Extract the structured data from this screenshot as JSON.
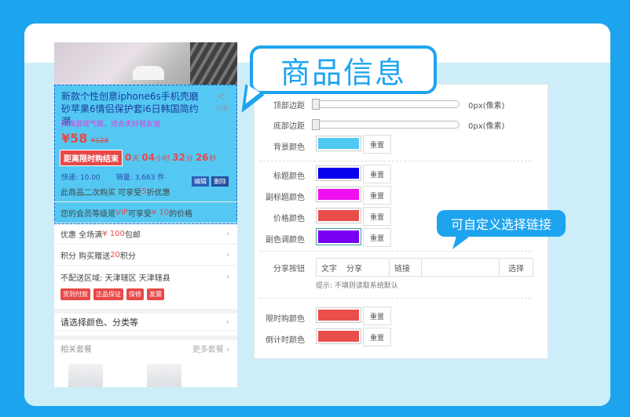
{
  "product": {
    "title": "新款个性创意iphone6s手机壳磨砂苹果6情侣保护套i6日韩国简约潮",
    "share_label": "分享",
    "subtitle": "四海游戏气歌，适合夫好朋友谊",
    "price": "¥58",
    "old_price": "¥128",
    "countdown_label": "距离限时购结束",
    "countdown": {
      "days": "0",
      "day_unit": "天",
      "hours": "04",
      "hour_unit": "小时",
      "minutes": "32",
      "min_unit": "分",
      "seconds": "26",
      "sec_unit": "秒"
    },
    "shipping": "快递: 10.00",
    "sales": "销量: 3,663 件",
    "edit_label": "编辑",
    "delete_label": "删除"
  },
  "rows": {
    "repurchase": {
      "pre": "此商品二次购买 可享受 ",
      "num": "5",
      "post": " 折优惠"
    },
    "vip": {
      "pre": "您的会员等级是 ",
      "level": "VIP",
      "mid": " 可享受 ",
      "amount": "¥ 10",
      "post": " 的价格"
    },
    "discount": {
      "pre": "优惠 全场满 ",
      "amount": "¥ 100",
      "post": " 包邮"
    },
    "points": {
      "pre": "积分 购买赠送 ",
      "num": "20",
      "post": " 积分"
    },
    "no_ship": "不配送区域: 天津辖区 天津辖县",
    "badges": [
      "货到付款",
      "正品保证",
      "保修",
      "发票"
    ],
    "select_spec": "请选择颜色、分类等",
    "related": "相关套餐",
    "more": "更多套餐"
  },
  "settings": {
    "top_margin": {
      "label": "顶部边距",
      "value": "0px(像素)"
    },
    "bottom_margin": {
      "label": "底部边距",
      "value": "0px(像素)"
    },
    "bg_color": {
      "label": "背景颜色",
      "color": "#4fc9f2"
    },
    "title_color": {
      "label": "标题颜色",
      "color": "#0a00ee"
    },
    "subtitle_color": {
      "label": "副标题颜色",
      "color": "#f00ff0"
    },
    "price_color": {
      "label": "价格颜色",
      "color": "#ea4e4b"
    },
    "accent_color": {
      "label": "副色调颜色",
      "color": "#7a00f5"
    },
    "reset_label": "重置",
    "share_button": {
      "label": "分享按钮",
      "text_label": "文字",
      "text_value": "分享",
      "link_label": "链接",
      "link_value": "",
      "select_label": "选择"
    },
    "hint": "提示: 不填则读取系统默认",
    "flash_color": {
      "label": "限时购颜色",
      "color": "#ea4e4b"
    },
    "countdown_color": {
      "label": "倒计时颜色",
      "color": "#ea4e4b"
    }
  },
  "callouts": {
    "product_info": "商品信息",
    "custom_link": "可自定义选择链接"
  }
}
